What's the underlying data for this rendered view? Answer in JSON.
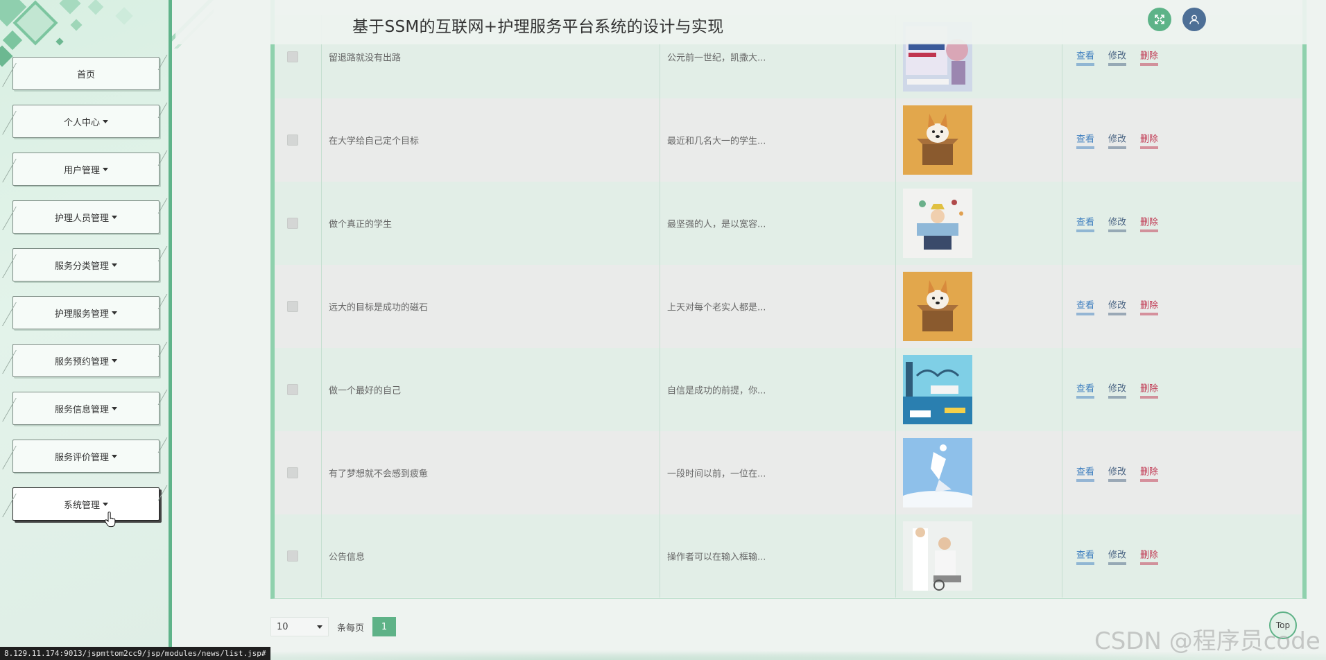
{
  "app": {
    "title": "基于SSM的互联网+护理服务平台系统的设计与实现"
  },
  "sidebar": {
    "items": [
      {
        "label": "首页",
        "has_caret": false
      },
      {
        "label": "个人中心",
        "has_caret": true
      },
      {
        "label": "用户管理",
        "has_caret": true
      },
      {
        "label": "护理人员管理",
        "has_caret": true
      },
      {
        "label": "服务分类管理",
        "has_caret": true
      },
      {
        "label": "护理服务管理",
        "has_caret": true
      },
      {
        "label": "服务预约管理",
        "has_caret": true
      },
      {
        "label": "服务信息管理",
        "has_caret": true
      },
      {
        "label": "服务评价管理",
        "has_caret": true
      },
      {
        "label": "系统管理",
        "has_caret": true
      }
    ]
  },
  "table": {
    "rows": [
      {
        "title": "留退路就没有出路",
        "intro": "公元前一世纪，凯撒大...",
        "thumb": "poster-image"
      },
      {
        "title": "在大学给自己定个目标",
        "intro": "最近和几名大一的学生...",
        "thumb": "corgi-box-image"
      },
      {
        "title": "做个真正的学生",
        "intro": "最坚强的人，是以宽容...",
        "thumb": "student-reading-image"
      },
      {
        "title": "远大的目标是成功的磁石",
        "intro": "上天对每个老实人都是...",
        "thumb": "corgi-box-image"
      },
      {
        "title": "做一个最好的自己",
        "intro": "自信是成功的前提，你...",
        "thumb": "china-transport-image"
      },
      {
        "title": "有了梦想就不会感到疲惫",
        "intro": "一段时间以前，一位在...",
        "thumb": "paper-bird-image"
      },
      {
        "title": "公告信息",
        "intro": "操作者可以在输入框输...",
        "thumb": "nurse-elderly-image"
      }
    ],
    "actions": {
      "view": "查看",
      "edit": "修改",
      "delete": "删除"
    }
  },
  "pagination": {
    "per_page_value": "10",
    "per_page_label": "条每页",
    "current_page": "1"
  },
  "back_to_top": "Top",
  "status_url": "8.129.11.174:9013/jspmttom2cc9/jsp/modules/news/list.jsp#",
  "watermark": "CSDN @程序员code",
  "colors": {
    "accent_green": "#5eb287",
    "view_link": "#3f7fbf",
    "edit_link": "#4a6483",
    "delete_link": "#c0344f",
    "user_button": "#4d6f96"
  }
}
